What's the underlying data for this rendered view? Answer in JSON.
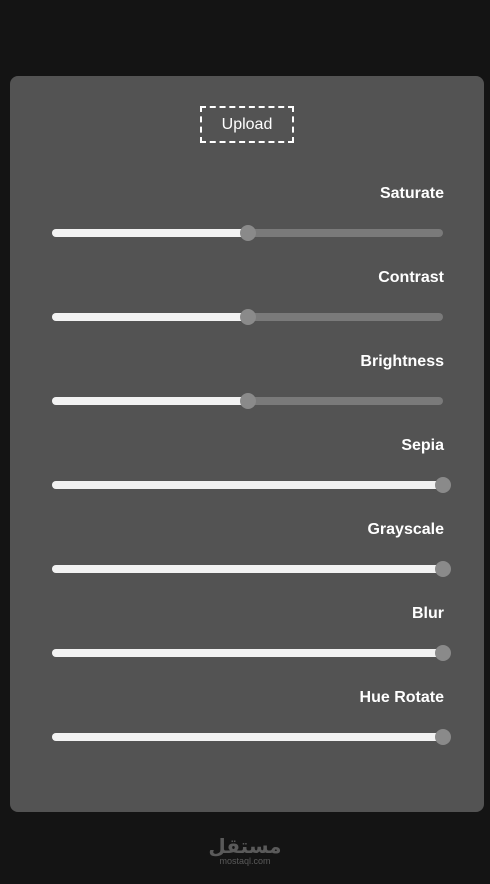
{
  "upload": {
    "label": "Upload"
  },
  "filters": [
    {
      "label": "Saturate",
      "value": 0.5
    },
    {
      "label": "Contrast",
      "value": 0.5
    },
    {
      "label": "Brightness",
      "value": 0.5
    },
    {
      "label": "Sepia",
      "value": 1.0
    },
    {
      "label": "Grayscale",
      "value": 1.0
    },
    {
      "label": "Blur",
      "value": 1.0
    },
    {
      "label": "Hue Rotate",
      "value": 1.0
    }
  ],
  "footer": {
    "logo_text": "مستقل",
    "logo_sub": "mostaql.com"
  },
  "colors": {
    "background": "#141414",
    "panel": "#535353",
    "track": "#7a7a7a",
    "fill": "#f2f2f2",
    "thumb": "#8a8a8a"
  }
}
